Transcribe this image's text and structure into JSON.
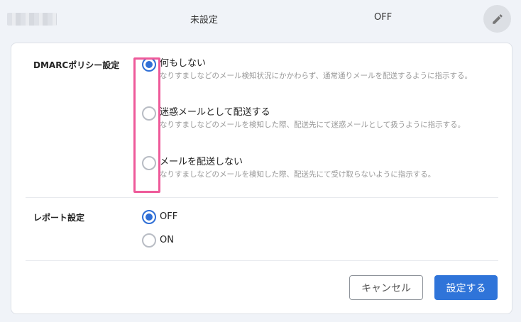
{
  "header": {
    "status_setting": "未設定",
    "status_toggle": "OFF"
  },
  "dmarc_policy": {
    "label": "DMARCポリシー設定",
    "options": [
      {
        "title": "何もしない",
        "description": "なりすましなどのメール検知状況にかかわらず、通常通りメールを配送するように指示する。",
        "selected": true
      },
      {
        "title": "迷惑メールとして配送する",
        "description": "なりすましなどのメールを検知した際、配送先にて迷惑メールとして扱うように指示する。",
        "selected": false
      },
      {
        "title": "メールを配送しない",
        "description": "なりすましなどのメールを検知した際、配送先にて受け取らないように指示する。",
        "selected": false
      }
    ]
  },
  "report_setting": {
    "label": "レポート設定",
    "options": [
      {
        "title": "OFF",
        "selected": true
      },
      {
        "title": "ON",
        "selected": false
      }
    ]
  },
  "actions": {
    "cancel_label": "キャンセル",
    "submit_label": "設定する"
  },
  "colors": {
    "accent": "#2f74d9",
    "highlight": "#ee5a9a"
  }
}
